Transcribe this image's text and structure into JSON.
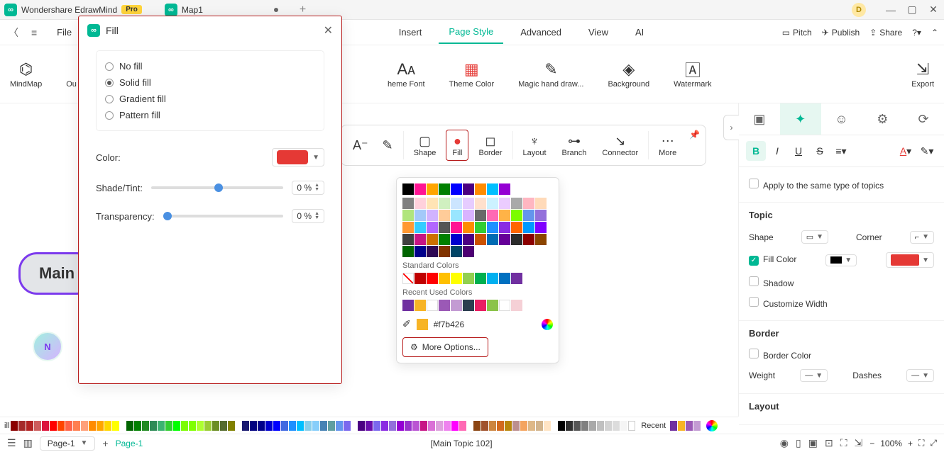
{
  "app": {
    "title": "Wondershare EdrawMind",
    "pro": "Pro",
    "doc": "Map1",
    "user_initial": "D"
  },
  "menu": {
    "file": "File",
    "items": [
      "Insert",
      "Page Style",
      "Advanced",
      "View",
      "AI"
    ],
    "active_index": 1,
    "right": {
      "pitch": "Pitch",
      "publish": "Publish",
      "share": "Share"
    }
  },
  "ribbon": {
    "mindmap": "MindMap",
    "outline": "Ou",
    "theme_font": "heme Font",
    "theme_color": "Theme Color",
    "magic": "Magic hand draw...",
    "background": "Background",
    "watermark": "Watermark",
    "export": "Export"
  },
  "dialog": {
    "title": "Fill",
    "opts": [
      "No fill",
      "Solid fill",
      "Gradient fill",
      "Pattern fill"
    ],
    "selected": 1,
    "color_label": "Color:",
    "shade_label": "Shade/Tint:",
    "trans_label": "Transparency:",
    "shade_val": "0 %",
    "trans_val": "0 %"
  },
  "float": {
    "items": [
      "Shape",
      "Fill",
      "Border",
      "Layout",
      "Branch",
      "Connector",
      "More"
    ],
    "active": 1
  },
  "palette": {
    "theme_row": [
      "#000000",
      "#ff1493",
      "#ffa500",
      "#008000",
      "#0000ff",
      "#4b0082",
      "#ff8c00",
      "#00bfff",
      "#9400d3"
    ],
    "grid": [
      [
        "#808080",
        "#ffd1dc",
        "#ffe4b5",
        "#d0f0c0",
        "#cce5ff",
        "#e6ccff",
        "#ffe0cc",
        "#ccf2ff",
        "#ebccff"
      ],
      [
        "#a9a9a9",
        "#ffb6c1",
        "#ffdab9",
        "#b0e57c",
        "#a3c9f9",
        "#d1b3ff",
        "#ffcc99",
        "#99e6ff",
        "#d9b3ff"
      ],
      [
        "#696969",
        "#ff69b4",
        "#ffb347",
        "#7cfc00",
        "#6495ed",
        "#9370db",
        "#ff9933",
        "#33ccff",
        "#b266ff"
      ],
      [
        "#555555",
        "#ff1493",
        "#ff8c00",
        "#32cd32",
        "#1e90ff",
        "#8a2be2",
        "#ff6600",
        "#0099ff",
        "#8000ff"
      ],
      [
        "#404040",
        "#c71585",
        "#cc7000",
        "#008000",
        "#0000cd",
        "#4b0082",
        "#cc5200",
        "#006bb3",
        "#660099"
      ],
      [
        "#2b2b2b",
        "#8b0000",
        "#8b4500",
        "#006400",
        "#00008b",
        "#2e0854",
        "#803300",
        "#004466",
        "#4d0073"
      ]
    ],
    "std_label": "Standard Colors",
    "std": [
      "#ffffff",
      "#c00000",
      "#ff0000",
      "#ffc000",
      "#ffff00",
      "#92d050",
      "#00b050",
      "#00b0f0",
      "#0070c0",
      "#7030a0"
    ],
    "std0_diag": true,
    "recent_label": "Recent Used Colors",
    "recent": [
      "#7030a0",
      "#f7b426",
      "#ffffff",
      "#9b59b6",
      "#c39bd3",
      "#2c3e50",
      "#e91e63",
      "#8bc34a",
      "#ffffff",
      "#f5d0d6"
    ],
    "hex": "#f7b426",
    "more": "More Options..."
  },
  "rpanel": {
    "apply": "Apply to the same type of topics",
    "topic": "Topic",
    "shape": "Shape",
    "corner": "Corner",
    "fill": "Fill Color",
    "shadow": "Shadow",
    "custw": "Customize Width",
    "border": "Border",
    "bcolor": "Border Color",
    "weight": "Weight",
    "dashes": "Dashes",
    "layout": "Layout"
  },
  "colorstrip": {
    "label": "ill",
    "recent": "Recent",
    "groups": [
      [
        "#8b0000",
        "#a52a2a",
        "#b22222",
        "#cd5c5c",
        "#dc143c",
        "#ff0000",
        "#ff4500",
        "#ff6347",
        "#ff7f50",
        "#ffa07a",
        "#ff8c00",
        "#ffa500",
        "#ffd700",
        "#ffff00"
      ],
      [
        "#006400",
        "#008000",
        "#228b22",
        "#2e8b57",
        "#3cb371",
        "#32cd32",
        "#00ff00",
        "#7cfc00",
        "#7fff00",
        "#adff2f",
        "#9acd32",
        "#6b8e23",
        "#556b2f",
        "#808000"
      ],
      [
        "#191970",
        "#000080",
        "#00008b",
        "#0000cd",
        "#0000ff",
        "#4169e1",
        "#1e90ff",
        "#00bfff",
        "#87ceeb",
        "#87cefa",
        "#4682b4",
        "#5f9ea0",
        "#6495ed",
        "#7b68ee"
      ],
      [
        "#4b0082",
        "#6a0dad",
        "#7b68ee",
        "#8a2be2",
        "#9370db",
        "#9400d3",
        "#9932cc",
        "#ba55d3",
        "#c71585",
        "#da70d6",
        "#dda0dd",
        "#ee82ee",
        "#ff00ff",
        "#ff69b4"
      ],
      [
        "#8b4513",
        "#a0522d",
        "#cd853f",
        "#d2691e",
        "#b8860b",
        "#bc8f8f",
        "#f4a460",
        "#deb887",
        "#d2b48c",
        "#ffe4c4"
      ],
      [
        "#000000",
        "#2f2f2f",
        "#555555",
        "#808080",
        "#a9a9a9",
        "#c0c0c0",
        "#d3d3d3",
        "#dcdcdc",
        "#f5f5f5",
        "#ffffff"
      ]
    ],
    "recent_sw": [
      "#7030a0",
      "#f7b426",
      "#9b59b6",
      "#c39bd3"
    ]
  },
  "status": {
    "page": "Page-1",
    "page_tab": "Page-1",
    "sel": "[Main Topic 102]",
    "zoom": "100%"
  },
  "canvas": {
    "main": "Main"
  }
}
